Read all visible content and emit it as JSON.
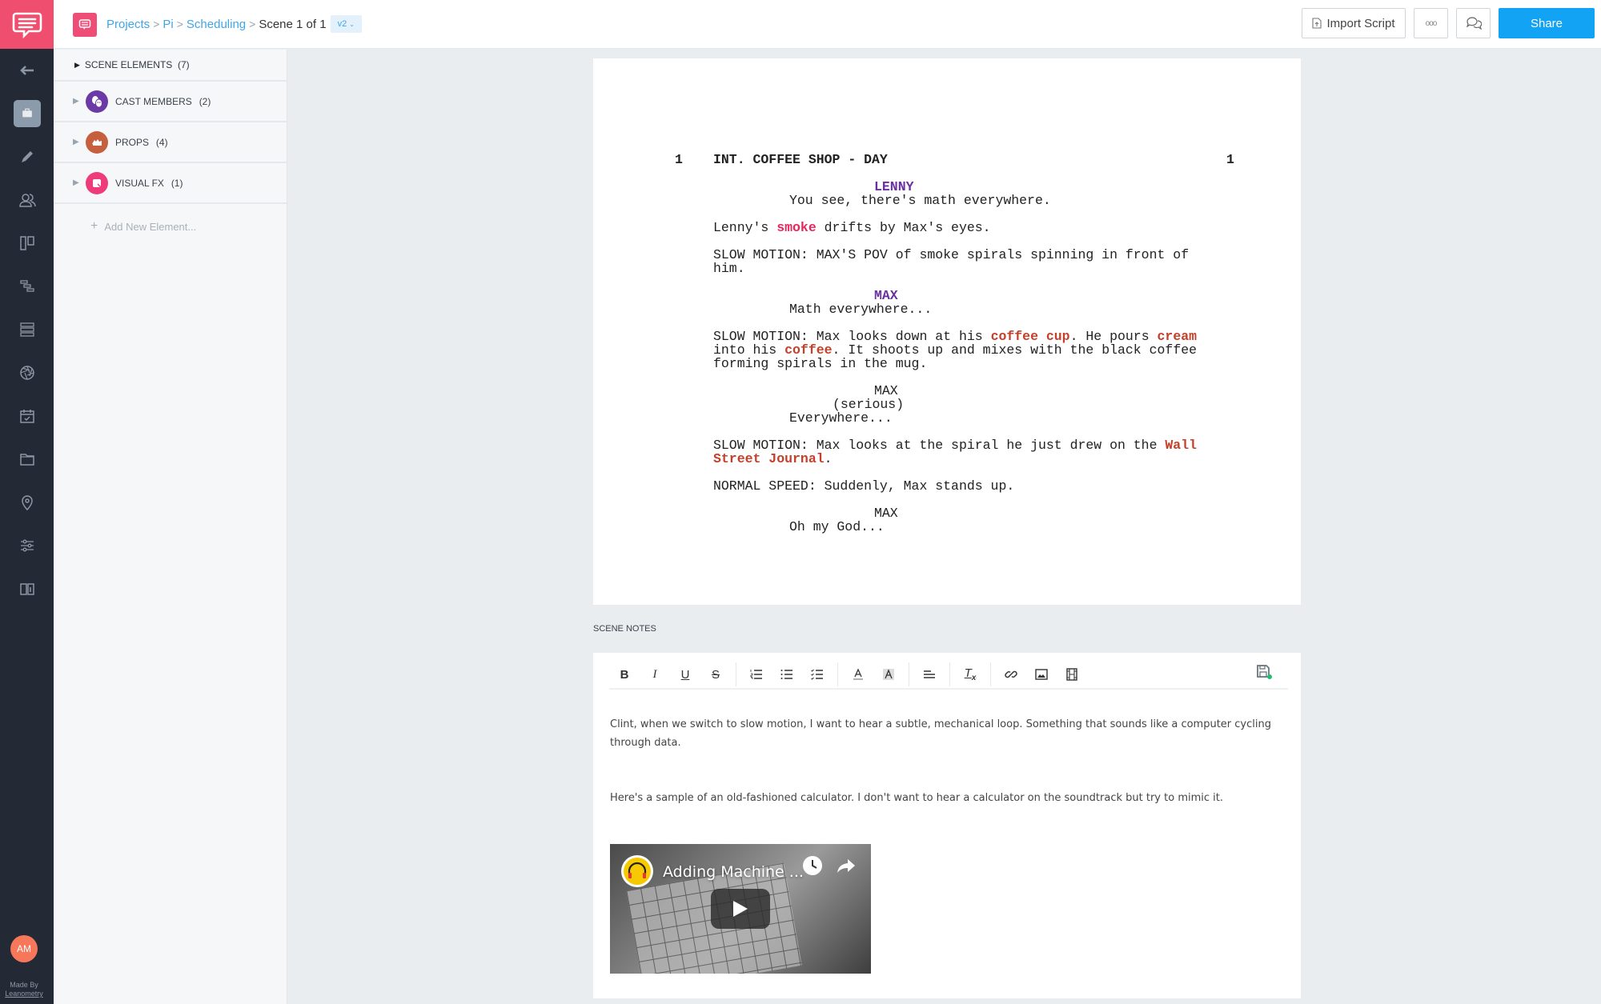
{
  "rail": {
    "items": [
      {
        "icon": "back-arrow-icon"
      },
      {
        "icon": "briefcase-icon",
        "active": true
      },
      {
        "icon": "pencil-icon"
      },
      {
        "icon": "users-icon"
      },
      {
        "icon": "storyboard-icon"
      },
      {
        "icon": "gantt-icon"
      },
      {
        "icon": "list-icon"
      },
      {
        "icon": "aperture-icon"
      },
      {
        "icon": "calendar-check-icon"
      },
      {
        "icon": "folder-icon"
      },
      {
        "icon": "location-pin-icon"
      },
      {
        "icon": "sliders-icon"
      },
      {
        "icon": "book-icon"
      }
    ],
    "avatar_initials": "AM",
    "made_by": "Made By",
    "made_by_brand": "Leanometry"
  },
  "topbar": {
    "breadcrumb": {
      "projects": "Projects",
      "project": "Pi",
      "section": "Scheduling",
      "current": "Scene 1 of 1",
      "version": "v2"
    },
    "import_label": "Import Script",
    "more_label": "ooo",
    "share_label": "Share"
  },
  "elements": {
    "header": "SCENE ELEMENTS",
    "header_count": "(7)",
    "categories": [
      {
        "label": "CAST MEMBERS",
        "count": "(2)",
        "color": "#6b3aa6",
        "icon": "theater-masks-icon"
      },
      {
        "label": "PROPS",
        "count": "(4)",
        "color": "#c55f3e",
        "icon": "props-icon"
      },
      {
        "label": "VISUAL FX",
        "count": "(1)",
        "color": "#ee3b7a",
        "icon": "visual-fx-icon"
      }
    ],
    "add_label": "Add New Element..."
  },
  "script": {
    "scene_number": "1",
    "slugline": "INT. COFFEE SHOP - DAY",
    "lines": {
      "c1": "LENNY",
      "d1": "You see, there's math everywhere.",
      "a1_pre": "Lenny's ",
      "a1_hl": "smoke",
      "a1_post": " drifts by Max's eyes.",
      "a2_l1": "SLOW MOTION: MAX'S POV of smoke spirals spinning in front of",
      "a2_l2": "him.",
      "c2": "MAX",
      "d2": "Math everywhere...",
      "a3_l1_pre": "SLOW MOTION: Max looks down at his ",
      "a3_l1_hl1": "coffee cup",
      "a3_l1_mid": ". He pours ",
      "a3_l1_hl2": "cream",
      "a3_l2_pre": "into his ",
      "a3_l2_hl": "coffee",
      "a3_l2_post": ". It shoots up and mixes with the black coffee",
      "a3_l3": "forming spirals in the mug.",
      "c3": "MAX",
      "p3": "(serious)",
      "d3": "Everywhere...",
      "a4_l1_pre": "SLOW MOTION: Max looks at the spiral he just drew on the ",
      "a4_l1_hl": "Wall",
      "a4_l2_hl": "Street Journal",
      "a4_l2_post": ".",
      "a5": "NORMAL SPEED: Suddenly, Max stands up.",
      "c4": "MAX",
      "d4": "Oh my God..."
    },
    "colors": {
      "character": "#6b2fa3",
      "visual_fx": "#e8265e",
      "prop": "#c5402a"
    }
  },
  "notes": {
    "label": "SCENE NOTES",
    "toolbar": [
      "bold",
      "italic",
      "underline",
      "strikethrough",
      "ordered-list",
      "bullet-list",
      "checklist",
      "text-color",
      "highlight",
      "align",
      "clear-format",
      "link",
      "image",
      "video"
    ],
    "toolbar_glyphs": {
      "bold": "B",
      "italic": "I",
      "underline": "U",
      "strike": "S",
      "clear": "T"
    },
    "paragraph_1": "Clint, when we switch to slow motion, I want to hear a subtle, mechanical loop. Something that sounds like a computer cycling through data.",
    "paragraph_2": "Here's a sample of an old-fashioned calculator. I don't want to hear a calculator on the soundtrack but try to mimic it.",
    "video_title": "Adding Machine ..."
  }
}
